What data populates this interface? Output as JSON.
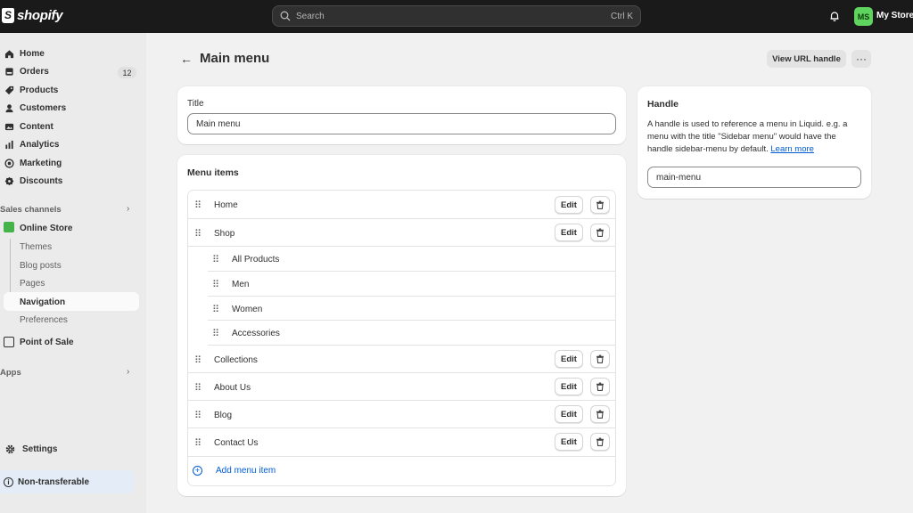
{
  "app": {
    "brand": "shopify",
    "store_name": "My Store",
    "avatar_initials": "MS"
  },
  "search": {
    "placeholder": "Search",
    "shortcut": "Ctrl K"
  },
  "sidebar": {
    "items": [
      {
        "label": "Home",
        "icon": "home-icon"
      },
      {
        "label": "Orders",
        "icon": "orders-icon",
        "badge": "12"
      },
      {
        "label": "Products",
        "icon": "tag-icon"
      },
      {
        "label": "Customers",
        "icon": "person-icon"
      },
      {
        "label": "Content",
        "icon": "image-icon"
      },
      {
        "label": "Analytics",
        "icon": "bar-chart-icon"
      },
      {
        "label": "Marketing",
        "icon": "target-icon"
      },
      {
        "label": "Discounts",
        "icon": "discount-icon"
      }
    ],
    "sales_channels_label": "Sales channels",
    "online_store": "Online Store",
    "sub_items": [
      "Themes",
      "Blog posts",
      "Pages",
      "Navigation",
      "Preferences"
    ],
    "point_of_sale": "Point of Sale",
    "apps_label": "Apps",
    "settings": "Settings",
    "non_transferable": "Non-transferable"
  },
  "page": {
    "title": "Main menu",
    "view_url_handle": "View URL handle",
    "more": "···"
  },
  "title_card": {
    "label": "Title",
    "value": "Main menu"
  },
  "menu_card": {
    "heading": "Menu items",
    "items": [
      {
        "label": "Home",
        "edit": "Edit"
      },
      {
        "label": "Shop",
        "edit": "Edit"
      },
      {
        "label": "All Products"
      },
      {
        "label": "Men"
      },
      {
        "label": "Women"
      },
      {
        "label": "Accessories"
      },
      {
        "label": "Collections",
        "edit": "Edit"
      },
      {
        "label": "About Us",
        "edit": "Edit"
      },
      {
        "label": "Blog",
        "edit": "Edit"
      },
      {
        "label": "Contact Us",
        "edit": "Edit"
      }
    ],
    "add_item": "Add menu item"
  },
  "handle_card": {
    "heading": "Handle",
    "help_line1": "A handle is used to reference a menu in Liquid. e.g. a",
    "help_line2": "menu with the title \"Sidebar menu\" would have the",
    "help_line3": "handle sidebar-menu by default.",
    "learn_more": "Learn more",
    "value": "main-menu"
  }
}
